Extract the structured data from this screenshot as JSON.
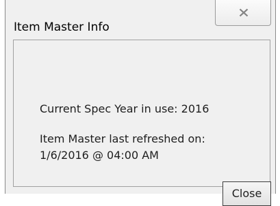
{
  "window": {
    "title": "Item Master Info"
  },
  "message": {
    "spec_year_line": "Current Spec Year in use: 2016",
    "refresh_line_1": "Item Master last refreshed on:",
    "refresh_line_2": "1/6/2016 @ 04:00 AM"
  },
  "buttons": {
    "close_label": "Close"
  },
  "icons": {
    "title_close": "close-icon"
  },
  "colors": {
    "window_bg": "#f0f0f0",
    "border": "#8a8a8a",
    "text": "#1e1e1e"
  }
}
